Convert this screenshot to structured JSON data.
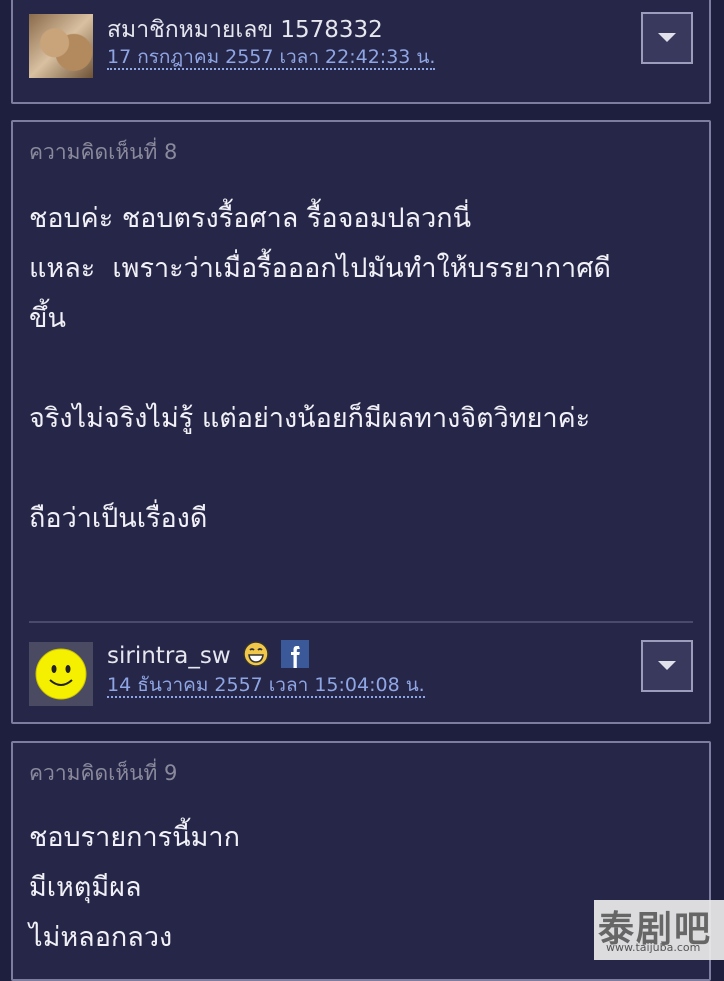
{
  "comments": [
    {
      "author": "สมาชิกหมายเลข 1578332",
      "datetime": "17 กรกฎาคม 2557 เวลา 22:42:33 น."
    },
    {
      "label": "ความคิดเห็นที่ 8",
      "body": "ชอบค่ะ ชอบตรงรื้อศาล รื้อจอมปลวกนี่\nแหละ  เพราะว่าเมื่อรื้อออกไปมันทำให้บรรยากาศดี\nขึ้น\n\nจริงไม่จริงไม่รู้ แต่อย่างน้อยก็มีผลทางจิตวิทยาค่ะ\n\nถือว่าเป็นเรื่องดี",
      "author": "sirintra_sw",
      "datetime": "14 ธันวาคม 2557 เวลา 15:04:08 น."
    },
    {
      "label": "ความคิดเห็นที่ 9",
      "body": "ชอบรายการนี้มาก\nมีเหตุมีผล\nไม่หลอกลวง"
    }
  ],
  "watermark": {
    "logo_text": "泰剧吧",
    "url": "www.taijuba.com"
  }
}
